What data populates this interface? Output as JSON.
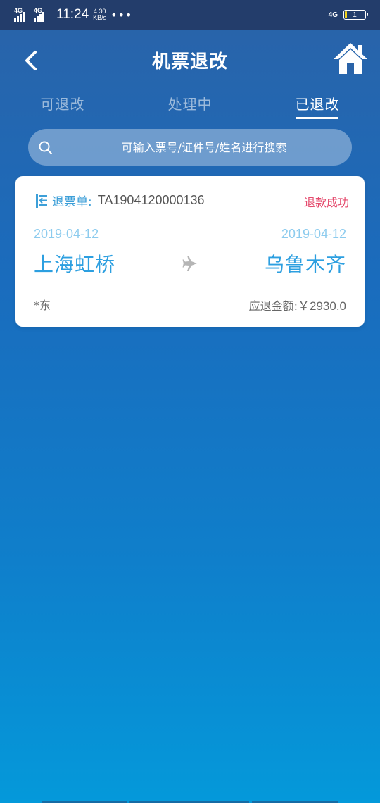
{
  "status_bar": {
    "network_left_1": "4G",
    "network_left_2": "4G",
    "time": "11:24",
    "speed_value": "4.30",
    "speed_unit": "KB/s",
    "dots": "•••",
    "network_right": "4G",
    "battery_level": "1"
  },
  "nav": {
    "title": "机票退改"
  },
  "tabs": [
    {
      "label": "可退改",
      "active": false
    },
    {
      "label": "处理中",
      "active": false
    },
    {
      "label": "已退改",
      "active": true
    }
  ],
  "search": {
    "placeholder": "可输入票号/证件号/姓名进行搜索"
  },
  "card": {
    "ticket_label": "退票单:",
    "ticket_number": "TA1904120000136",
    "status": "退款成功",
    "depart_date": "2019-04-12",
    "arrive_date": "2019-04-12",
    "depart_city": "上海虹桥",
    "arrive_city": "乌鲁木齐",
    "passenger": "*东",
    "refund_label": "应退金额:",
    "refund_value": "￥2930.0"
  },
  "colors": {
    "accent_blue": "#2c9fe0",
    "status_red": "#e54b6e",
    "date_blue": "#8ccbee"
  }
}
